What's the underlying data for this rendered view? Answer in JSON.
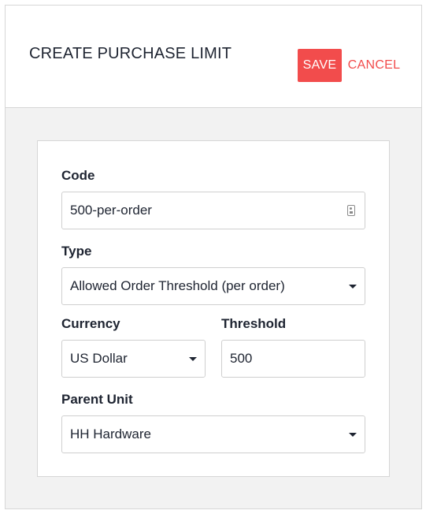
{
  "header": {
    "title": "CREATE PURCHASE LIMIT",
    "save_label": "SAVE",
    "cancel_label": "CANCEL"
  },
  "form": {
    "code": {
      "label": "Code",
      "value": "500-per-order",
      "icon": "contact-card-icon"
    },
    "type": {
      "label": "Type",
      "value": "Allowed Order Threshold (per order)"
    },
    "currency": {
      "label": "Currency",
      "value": "US Dollar"
    },
    "threshold": {
      "label": "Threshold",
      "value": "500"
    },
    "parent_unit": {
      "label": "Parent Unit",
      "value": "HH Hardware"
    }
  },
  "colors": {
    "accent": "#f24c4c",
    "text": "#1e2431",
    "panel_bg": "#f2f2f2",
    "border": "#d6d6d6"
  }
}
